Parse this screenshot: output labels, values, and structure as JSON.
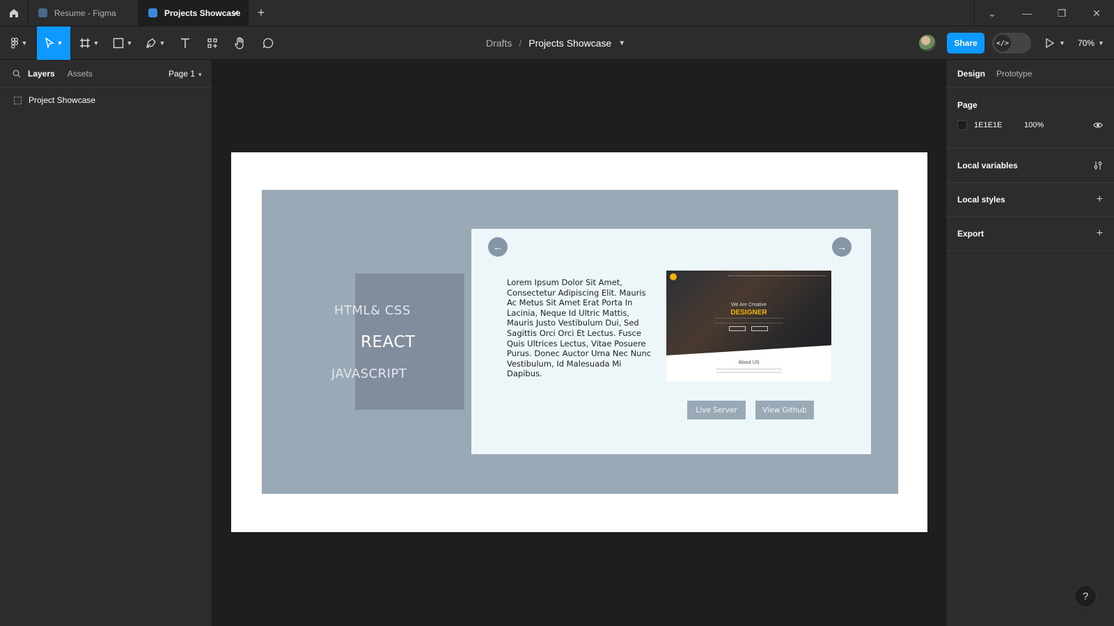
{
  "tabs": [
    {
      "label": "Resume - Figma",
      "active": false
    },
    {
      "label": "Projects Showcase",
      "active": true
    }
  ],
  "window_controls": {
    "close_tab": "✕",
    "add_tab": "+"
  },
  "toolbar": {
    "breadcrumb_root": "Drafts",
    "breadcrumb_file": "Projects Showcase",
    "share_label": "Share",
    "dev_mode_glyph": "</>",
    "zoom": "70%"
  },
  "left_panel": {
    "tab_layers": "Layers",
    "tab_assets": "Assets",
    "page_selector": "Page 1",
    "layers": [
      "Project Showcase"
    ]
  },
  "right_panel": {
    "tab_design": "Design",
    "tab_prototype": "Prototype",
    "page_section": "Page",
    "page_color": "1E1E1E",
    "page_opacity": "100%",
    "local_variables": "Local variables",
    "local_styles": "Local styles",
    "export": "Export"
  },
  "artboard": {
    "tech": [
      "HTML& CSS",
      "REACT",
      "JAVASCRIPT"
    ],
    "description": "Lorem Ipsum Dolor Sit Amet, Consectetur Adipiscing Elit.  Mauris Ac Metus Sit Amet Erat Porta In Lacinia, Neque Id Ultric Mattis, Mauris Justo Vestibulum Dui, Sed Sagittis Orci Orci Et Lectus. Fusce Quis Ultrices Lectus, Vitae Posuere Purus. Donec Auctor Urna Nec Nunc Vestibulum, Id Malesuada Mi Dapibus.",
    "preview": {
      "tagline": "We Are Creative",
      "headline": "DESIGNER",
      "about": "About US"
    },
    "btn_live": "Live Server",
    "btn_github": "View Github",
    "arrow_prev": "←",
    "arrow_next": "→"
  },
  "help": "?",
  "colors": {
    "accent": "#0d99ff",
    "slate": "#9aa9b6",
    "card": "#edf6f8",
    "highlight": "#f2b400"
  }
}
